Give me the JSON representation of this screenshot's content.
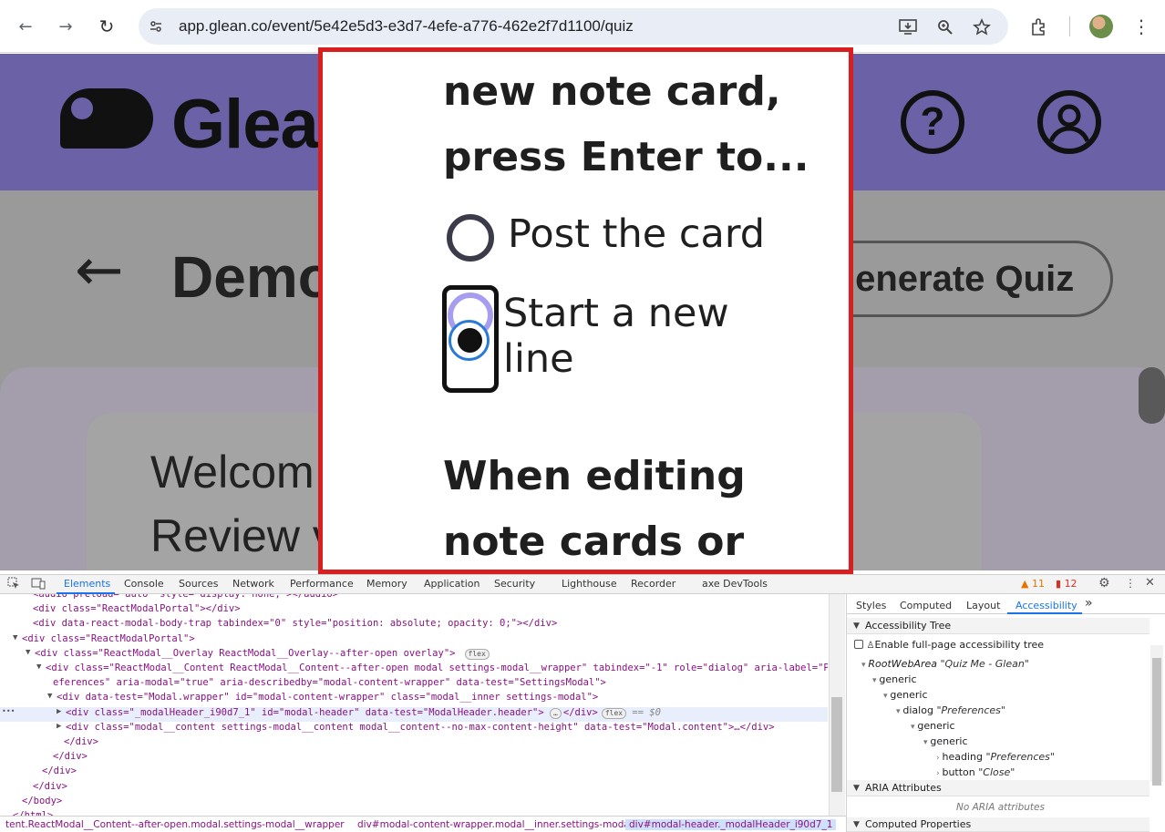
{
  "browser": {
    "url": "app.glean.co/event/5e42e5d3-e3d7-4efe-a776-462e2f7d1100/quiz",
    "back_glyph": "←",
    "forward_glyph": "→",
    "reload_glyph": "↻",
    "menu_glyph": "⋮"
  },
  "page": {
    "brand": "Glea",
    "help_glyph": "?",
    "page_title": "Demo",
    "generate_quiz": "Generate Quiz",
    "welcome": "Welcom",
    "review": "Review v",
    "back_glyph": "←"
  },
  "modal": {
    "line1": "new note card,",
    "line2": "press Enter to...",
    "option_post": "Post the card",
    "option_new_1": "Start a new",
    "option_new_2": "line",
    "line3": "When editing",
    "line4": "note cards or"
  },
  "devtools": {
    "tabs": [
      "Elements",
      "Console",
      "Sources",
      "Network",
      "Performance",
      "Memory",
      "Application",
      "Security",
      "Lighthouse",
      "Recorder",
      "axe DevTools"
    ],
    "warnings": "11",
    "issues": "12",
    "elements": [
      {
        "indent": 36,
        "tri": "",
        "html": "<audio preload=\"auto\" style=\"display: none;\"></audio>"
      },
      {
        "indent": 36,
        "tri": "",
        "html": "<div class=\"ReactModalPortal\"></div>"
      },
      {
        "indent": 36,
        "tri": "",
        "html": "<div data-react-modal-body-trap tabindex=\"0\" style=\"position: absolute; opacity: 0;\"></div>"
      },
      {
        "indent": 24,
        "tri": "▼",
        "html": "<div class=\"ReactModalPortal\">"
      },
      {
        "indent": 38,
        "tri": "▼",
        "html": "<div class=\"ReactModal__Overlay ReactModal__Overlay--after-open overlay\">",
        "chip": "flex"
      },
      {
        "indent": 50,
        "tri": "▼",
        "html": "<div class=\"ReactModal__Content ReactModal__Content--after-open modal settings-modal__wrapper\" tabindex=\"-1\" role=\"dialog\" aria-label=\"Pr"
      },
      {
        "indent": 58,
        "tri": "",
        "html": "eferences\" aria-modal=\"true\" aria-describedby=\"modal-content-wrapper\" data-test=\"SettingsModal\">"
      },
      {
        "indent": 62,
        "tri": "▼",
        "html": "<div data-test=\"Modal.wrapper\" id=\"modal-content-wrapper\" class=\"modal__inner settings-modal\">"
      },
      {
        "indent": 72,
        "tri": "▶",
        "html": "<div class=\"_modalHeader_i90d7_1\" id=\"modal-header\" data-test=\"ModalHeader.header\">",
        "chip": "flex",
        "tail": "== $0",
        "selected": true
      },
      {
        "indent": 72,
        "tri": "▶",
        "html": "<div class=\"modal__content settings-modal__content modal__content--no-max-content-height\" data-test=\"Modal.content\">…</div>"
      },
      {
        "indent": 70,
        "tri": "",
        "html": "</div>"
      },
      {
        "indent": 58,
        "tri": "",
        "html": "</div>"
      },
      {
        "indent": 46,
        "tri": "",
        "html": "</div>"
      },
      {
        "indent": 36,
        "tri": "",
        "html": "</div>"
      },
      {
        "indent": 24,
        "tri": "",
        "html": "</body>"
      },
      {
        "indent": 14,
        "tri": "",
        "html": "</html>"
      }
    ],
    "breadcrumbs": [
      {
        "text": "tent.ReactModal__Content--after-open.modal.settings-modal__wrapper"
      },
      {
        "text": "div#modal-content-wrapper.modal__inner.settings-modal"
      },
      {
        "text": "div#modal-header._modalHeader_i90d7_1",
        "selected": true
      }
    ],
    "side_tabs": [
      "Styles",
      "Computed",
      "Layout",
      "Accessibility"
    ],
    "accessibility_tree": "Accessibility Tree",
    "enable_full_page": "Enable full-page accessibility tree",
    "tree": [
      {
        "indent": 16,
        "toggle": "▾",
        "label": "RootWebArea",
        "name": "\"Quiz Me - Glean\""
      },
      {
        "indent": 28,
        "toggle": "▾",
        "label": "generic",
        "name": ""
      },
      {
        "indent": 40,
        "toggle": "▾",
        "label": "generic",
        "name": ""
      },
      {
        "indent": 54,
        "toggle": "▾",
        "label": "dialog",
        "name": "\"Preferences\""
      },
      {
        "indent": 70,
        "toggle": "▾",
        "label": "generic",
        "name": ""
      },
      {
        "indent": 84,
        "toggle": "▾",
        "label": "generic",
        "name": ""
      },
      {
        "indent": 98,
        "toggle": "›",
        "label": "heading",
        "name": "\"Preferences\""
      },
      {
        "indent": 98,
        "toggle": "›",
        "label": "button",
        "name": "\"Close\""
      }
    ],
    "aria_attributes": "ARIA Attributes",
    "no_aria": "No ARIA attributes",
    "computed_props": "Computed Properties"
  }
}
